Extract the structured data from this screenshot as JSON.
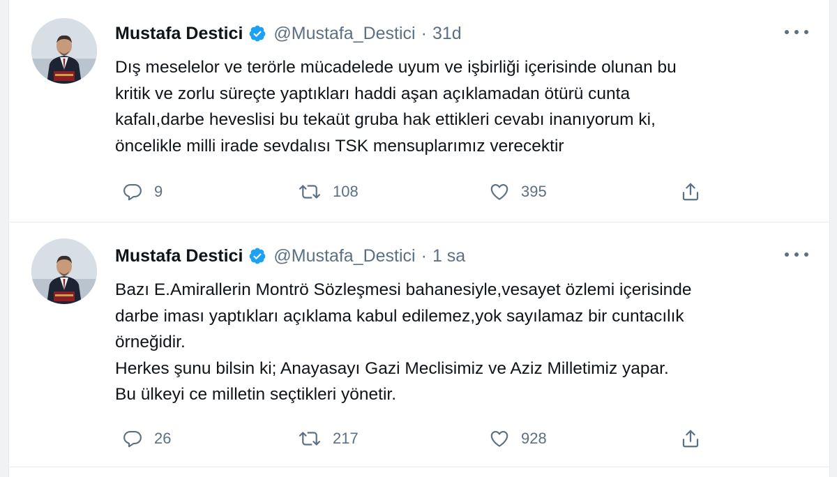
{
  "tweets": [
    {
      "author_name": "Mustafa Destici",
      "handle": "@Mustafa_Destici",
      "separator": "·",
      "time": "31d",
      "text_lines": [
        "Dış meselelor ve terörle mücadelede uyum ve işbirliği içerisinde olunan bu",
        "kritik ve zorlu süreçte yaptıkları haddi aşan açıklamadan ötürü cunta",
        "kafalı,darbe heveslisi bu tekaüt gruba hak ettikleri cevabı inanıyorum ki,",
        "öncelikle milli irade sevdalısı TSK mensuplarımız verecektir"
      ],
      "replies": "9",
      "retweets": "108",
      "likes": "395"
    },
    {
      "author_name": "Mustafa Destici",
      "handle": "@Mustafa_Destici",
      "separator": "·",
      "time": "1 sa",
      "text_lines": [
        "Bazı E.Amirallerin Montrö Sözleşmesi bahanesiyle,vesayet özlemi içerisinde",
        "darbe iması yaptıkları açıklama kabul edilemez,yok sayılamaz bir cuntacılık",
        "örneğidir.",
        "Herkes şunu bilsin ki; Anayasayı Gazi Meclisimiz ve Aziz Milletimiz yapar.",
        "Bu ülkeyi ce milletin seçtikleri yönetir."
      ],
      "replies": "26",
      "retweets": "217",
      "likes": "928"
    }
  ],
  "icons": {
    "verified": "verified-badge-icon",
    "more": "more-horizontal-icon",
    "reply": "reply-icon",
    "retweet": "retweet-icon",
    "like": "heart-icon",
    "share": "share-icon"
  },
  "colors": {
    "verified": "#1da1f2",
    "secondary_text": "#5b7083",
    "primary_text": "#0f1419",
    "divider": "#e6ecf0"
  }
}
